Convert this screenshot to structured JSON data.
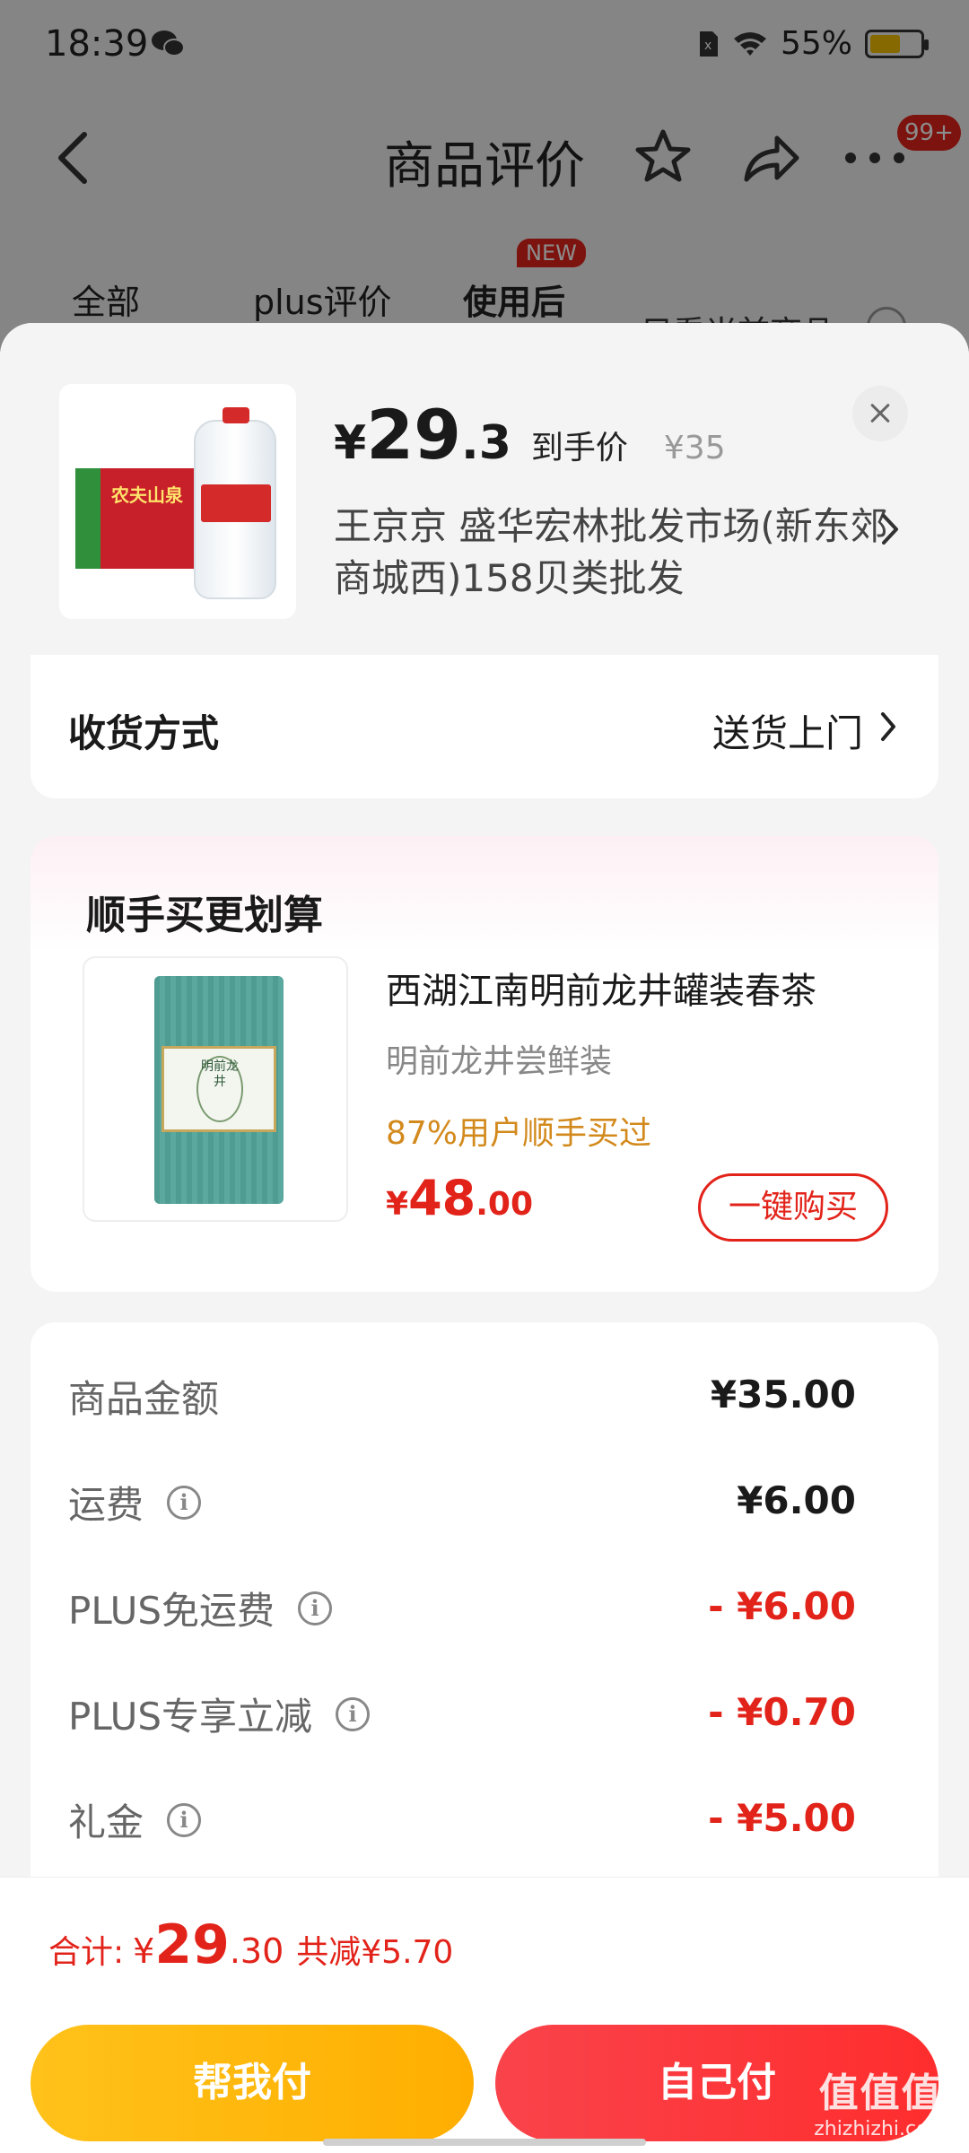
{
  "status_bar": {
    "time": "18:39",
    "battery": "55%"
  },
  "nav": {
    "title": "商品评价",
    "badge": "99+"
  },
  "tabs": {
    "all": "全部",
    "plus": "plus评价",
    "after_use": "使用后",
    "new_tag": "NEW",
    "only_current": "只看当前商品"
  },
  "product": {
    "price_yen": "¥",
    "price_int": "29",
    "price_dec": ".3",
    "price_label": "到手价",
    "original_price": "¥35",
    "shop": "王京京  盛华宏林批发市场(新东郊商城西)158贝类批发",
    "box_brand": "农夫山泉"
  },
  "delivery": {
    "label": "收货方式",
    "value": "送货上门"
  },
  "upsell": {
    "title": "顺手买更划算",
    "name": "西湖江南明前龙井罐装春茶",
    "subtitle": "明前龙井尝鲜装",
    "buy_rate": "87%用户顺手买过",
    "price_yen": "¥",
    "price_int": "48",
    "price_dec": ".00",
    "buy_button": "一键购买",
    "tin_label": "明前龙井"
  },
  "summary": {
    "rows": [
      {
        "label": "商品金额",
        "value": "¥35.00",
        "has_info": false,
        "red": false
      },
      {
        "label": "运费",
        "value": "¥6.00",
        "has_info": true,
        "red": false
      },
      {
        "label": "PLUS免运费",
        "value": "- ¥6.00",
        "has_info": true,
        "red": true
      },
      {
        "label": "PLUS专享立减",
        "value": "- ¥0.70",
        "has_info": true,
        "red": true
      },
      {
        "label": "礼金",
        "value": "- ¥5.00",
        "has_info": true,
        "red": true
      }
    ]
  },
  "footer": {
    "total_label": "合计:",
    "total_yen": "¥",
    "total_int": "29",
    "total_dec": ".30",
    "saved": "共减¥5.70",
    "help_pay": "帮我付",
    "self_pay": "自己付"
  },
  "watermark": {
    "main": "值值值",
    "site": "zhizhizhi.com"
  },
  "colors": {
    "accent": "#e2231a",
    "yellow": "#ffb400",
    "rate": "#d38a1d"
  }
}
